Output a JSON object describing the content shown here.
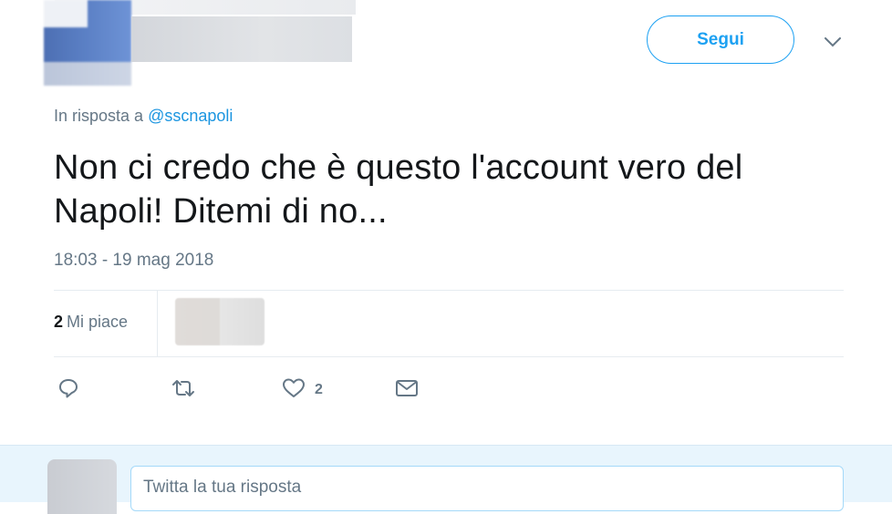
{
  "header": {
    "follow_label": "Segui",
    "caret_icon": "chevron-down-icon"
  },
  "tweet": {
    "reply_prefix": "In risposta a",
    "reply_handle": "@sscnapoli",
    "text_line1": "Non ci credo che è questo l'account vero del",
    "text_line2": "Napoli! Ditemi di no...",
    "timestamp": "18:03 - 19 mag 2018"
  },
  "stats": {
    "likes_count": "2",
    "likes_label": "Mi piace"
  },
  "actions": {
    "reply_icon": "reply-icon",
    "retweet_icon": "retweet-icon",
    "like_icon": "heart-icon",
    "like_count": "2",
    "message_icon": "envelope-icon"
  },
  "reply_box": {
    "placeholder": "Twitta la tua risposta"
  },
  "colors": {
    "accent": "#1da1f2",
    "link": "#1b95e0",
    "muted": "#657786",
    "reply_area_bg": "#e8f5fd"
  }
}
